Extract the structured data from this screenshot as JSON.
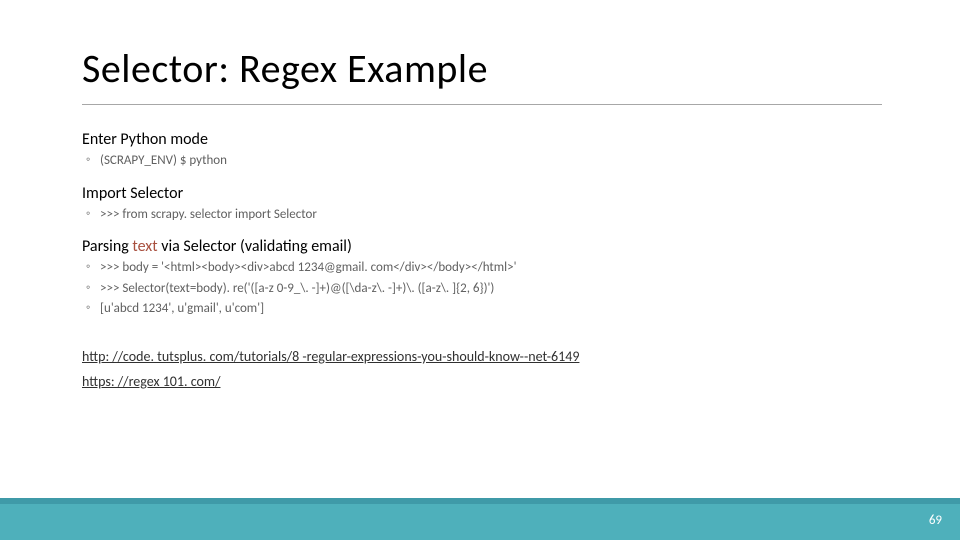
{
  "title": "Selector: Regex Example",
  "section1": {
    "head": "Enter Python mode",
    "items": [
      "(SCRAPY_ENV) $ python"
    ]
  },
  "section2": {
    "head": "Import Selector",
    "items": [
      ">>> from scrapy. selector import Selector"
    ]
  },
  "section3": {
    "head_pre": "Parsing ",
    "head_accent": "text",
    "head_post": " via Selector (validating email)",
    "items": [
      ">>> body = '<html><body><div>abcd 1234@gmail. com</div></body></html>'",
      ">>> Selector(text=body). re('([a-z 0-9_\\. -]+)@([\\da-z\\. -]+)\\. ([a-z\\. ]{2, 6})')",
      "[u'abcd 1234', u'gmail', u'com']"
    ]
  },
  "links": {
    "a": "http: //code. tutsplus. com/tutorials/8 -regular-expressions-you-should-know--net-6149",
    "b": "https: //regex 101. com/"
  },
  "page": "69"
}
